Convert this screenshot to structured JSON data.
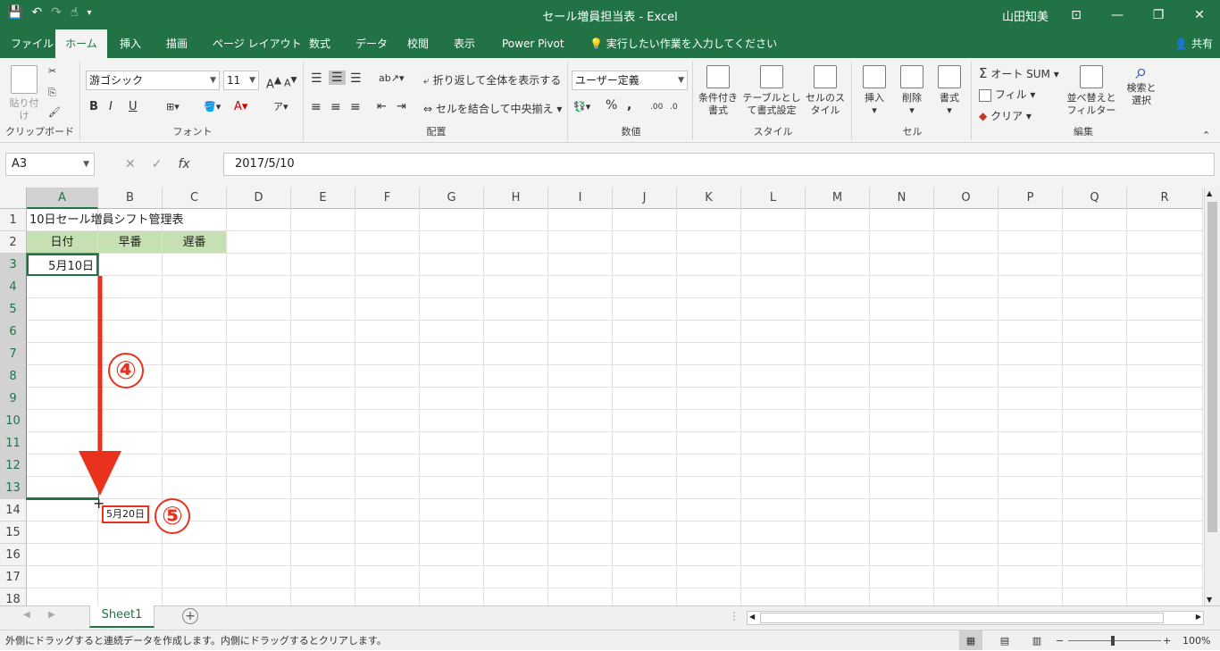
{
  "title": "セール増員担当表 - Excel",
  "user": "山田知美",
  "tabs": [
    "ファイル",
    "ホーム",
    "挿入",
    "描画",
    "ページ レイアウト",
    "数式",
    "データ",
    "校閲",
    "表示",
    "Power Pivot"
  ],
  "tell_me": "実行したい作業を入力してください",
  "share": "共有",
  "ribbon": {
    "clipboard": {
      "paste": "貼り付け",
      "label": "クリップボード"
    },
    "font": {
      "name": "游ゴシック",
      "size": "11",
      "bold": "B",
      "italic": "I",
      "underline": "U",
      "label": "フォント"
    },
    "align": {
      "wrap": "折り返して全体を表示する",
      "merge": "セルを結合して中央揃え",
      "label": "配置"
    },
    "number": {
      "format": "ユーザー定義",
      "percent": "%",
      "comma": ",",
      "label": "数値"
    },
    "styles": {
      "conditional": "条件付き書式",
      "table": "テーブルとして書式設定",
      "cell": "セルのスタイル",
      "label": "スタイル"
    },
    "cells": {
      "insert": "挿入",
      "delete": "削除",
      "format": "書式",
      "label": "セル"
    },
    "edit": {
      "autosum": "オート SUM",
      "fill": "フィル",
      "clear": "クリア",
      "sort": "並べ替えとフィルター",
      "find": "検索と選択",
      "label": "編集"
    }
  },
  "formula": {
    "namebox": "A3",
    "value": "2017/5/10",
    "fx": "fx"
  },
  "columns": [
    "A",
    "B",
    "C",
    "D",
    "E",
    "F",
    "G",
    "H",
    "I",
    "J",
    "K",
    "L",
    "M",
    "N",
    "O",
    "P",
    "Q",
    "R"
  ],
  "rows": [
    "1",
    "2",
    "3",
    "4",
    "5",
    "6",
    "7",
    "8",
    "9",
    "10",
    "11",
    "12",
    "13",
    "14",
    "15",
    "16",
    "17",
    "18"
  ],
  "cells": {
    "a1": "10日セール増員シフト管理表",
    "a2": "日付",
    "b2": "早番",
    "c2": "遅番",
    "a3": "5月10日"
  },
  "annotations": {
    "step4": "④",
    "step5": "⑤",
    "tooltip": "5月20日"
  },
  "sheet": {
    "name": "Sheet1"
  },
  "status": {
    "message": "外側にドラッグすると連続データを作成します。内側にドラッグするとクリアします。",
    "zoom": "100%"
  },
  "colors": {
    "excel_green": "#217346",
    "header_fill": "#c6e0b4",
    "annotation_red": "#e8321e"
  }
}
